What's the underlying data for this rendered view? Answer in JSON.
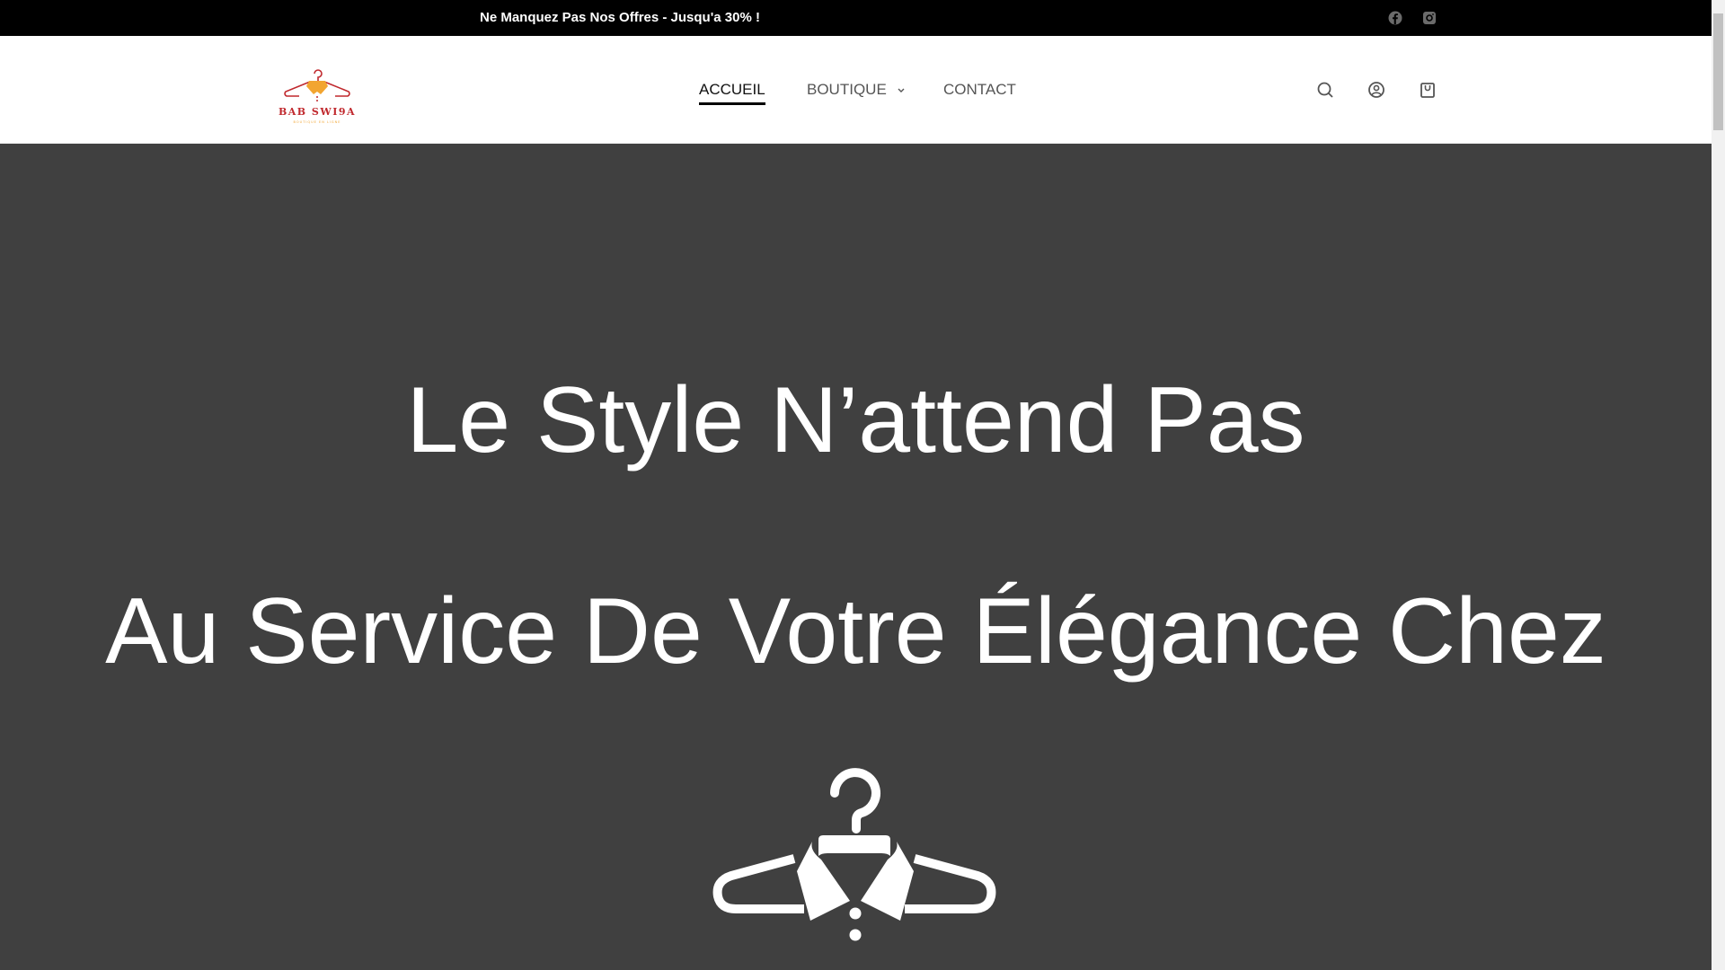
{
  "topbar": {
    "promo": "Ne Manquez Pas Nos Offres - Jusqu'a 30% !"
  },
  "header": {
    "logo": {
      "name": "BAB SWI9A",
      "tagline": "BOUTIQUE EN LIGNE"
    },
    "nav": [
      {
        "label": "ACCUEIL"
      },
      {
        "label": "BOUTIQUE"
      },
      {
        "label": "CONTACT"
      }
    ]
  },
  "hero": {
    "line1": "Le Style N’attend Pas",
    "line2": "Au Service De Votre Élégance Chez"
  },
  "colors": {
    "logo_red": "#c0282d",
    "logo_orange": "#f2a531",
    "hero_bg": "#404040"
  }
}
